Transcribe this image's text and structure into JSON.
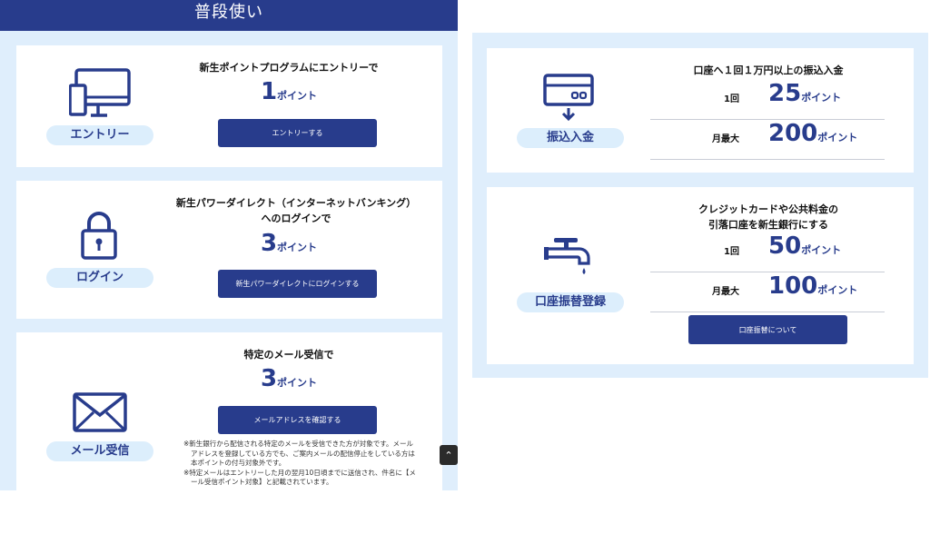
{
  "section_title": "普段使い",
  "entry": {
    "label": "エントリー",
    "title": "新生ポイントプログラムにエントリーで",
    "points": "1",
    "unit": "ポイント",
    "button": "エントリーする"
  },
  "login": {
    "label": "ログイン",
    "title_line1": "新生パワーダイレクト（インターネットバンキング）",
    "title_line2": "へのログインで",
    "points": "3",
    "unit": "ポイント",
    "button": "新生パワーダイレクトにログインする"
  },
  "mail": {
    "label": "メール受信",
    "title": "特定のメール受信で",
    "points": "3",
    "unit": "ポイント",
    "button": "メールアドレスを確認する",
    "notes": [
      "※新生銀行から配信される特定のメールを受信できた方が対象です。メールアドレスを登録している方でも、ご案内メールの配信停止をしている方は本ポイントの付与対象外です。",
      "※特定メールはエントリーした月の翌月10日頃までに送信され、件名に【メール受信ポイント対象】と記載されています。"
    ]
  },
  "transfer": {
    "label": "振込入金",
    "title": "口座へ１回１万円以上の振込入金",
    "rows": [
      {
        "label": "1回",
        "points": "25",
        "unit": "ポイント"
      },
      {
        "label": "月最大",
        "points": "200",
        "unit": "ポイント"
      }
    ]
  },
  "debit": {
    "label": "口座振替登録",
    "title_line1": "クレジットカードや公共料金の",
    "title_line2": "引落口座を新生銀行にする",
    "rows": [
      {
        "label": "1回",
        "points": "50",
        "unit": "ポイント"
      },
      {
        "label": "月最大",
        "points": "100",
        "unit": "ポイント"
      }
    ],
    "button": "口座振替について"
  },
  "colors": {
    "brand": "#283c8c",
    "panel_bg": "#dfeefc",
    "pill_bg": "#dceefc"
  },
  "icons": [
    "monitor-icon",
    "lock-icon",
    "envelope-icon",
    "card-icon",
    "faucet-icon",
    "chevron-up-icon"
  ]
}
